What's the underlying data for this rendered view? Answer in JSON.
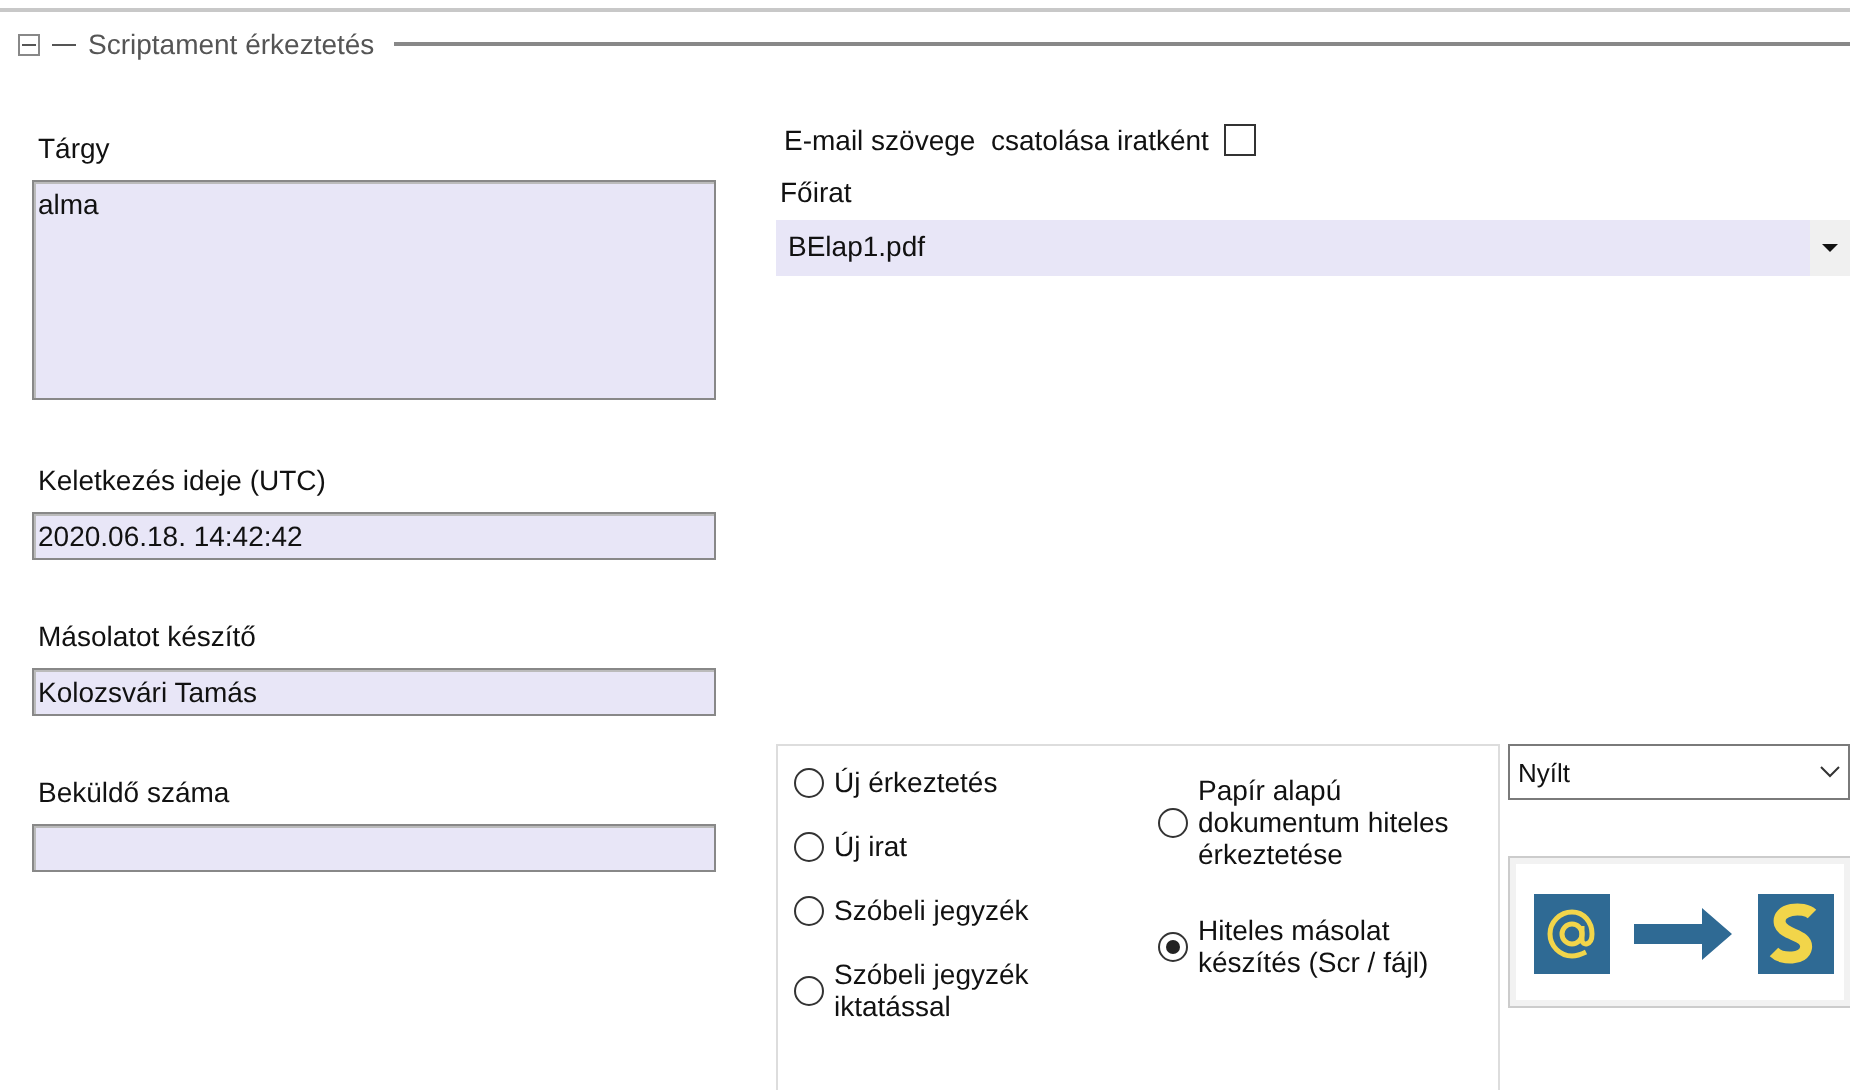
{
  "section": {
    "title": "Scriptament érkeztetés",
    "expanded": true
  },
  "left_fields": [
    {
      "label": "Tárgy",
      "value": "alma",
      "kind": "multiline"
    },
    {
      "label": "Keletkezés ideje (UTC)",
      "value": "2020.06.18. 14:42:42",
      "kind": "line"
    },
    {
      "label": "Másolatot készítő",
      "value": "Kolozsvári Tamás",
      "kind": "line"
    },
    {
      "label": "Beküldő száma",
      "kind": "line"
    }
  ],
  "attach_checkbox": {
    "label": "E-mail szövege  csatolása iratként",
    "checked": false
  },
  "main_document": {
    "label": "Főirat",
    "value": "BElap1.pdf"
  },
  "radio_columns": [
    [
      {
        "label": "Új érkeztetés",
        "selected": false
      },
      {
        "label": "Új irat",
        "selected": false
      },
      {
        "label": "Szóbeli jegyzék",
        "selected": false
      },
      {
        "label": "Szóbeli jegyzék iktatással",
        "selected": false
      }
    ],
    [
      {
        "label": "Papír alapú dokumentum hiteles érkeztetése",
        "selected": false
      },
      {
        "label": "Hiteles másolat készítés (Scr / fájl)",
        "selected": true
      }
    ]
  ],
  "access_dropdown": {
    "value": "Nyílt"
  }
}
